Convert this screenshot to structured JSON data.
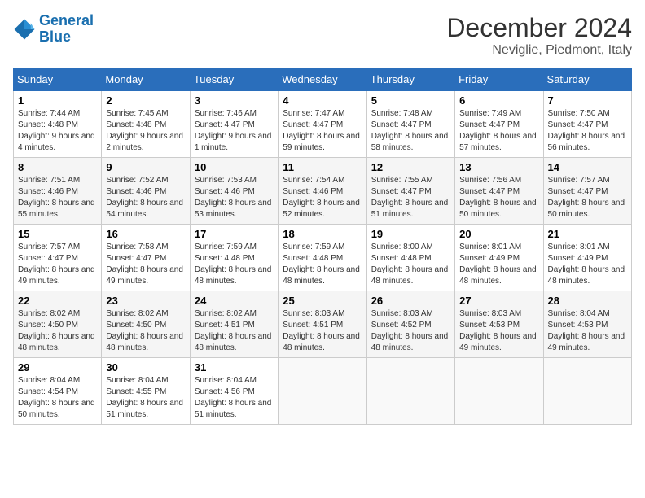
{
  "logo": {
    "text_general": "General",
    "text_blue": "Blue"
  },
  "header": {
    "month": "December 2024",
    "location": "Neviglie, Piedmont, Italy"
  },
  "days_of_week": [
    "Sunday",
    "Monday",
    "Tuesday",
    "Wednesday",
    "Thursday",
    "Friday",
    "Saturday"
  ],
  "weeks": [
    [
      {
        "day": "1",
        "sunrise": "7:44 AM",
        "sunset": "4:48 PM",
        "daylight": "9 hours and 4 minutes."
      },
      {
        "day": "2",
        "sunrise": "7:45 AM",
        "sunset": "4:48 PM",
        "daylight": "9 hours and 2 minutes."
      },
      {
        "day": "3",
        "sunrise": "7:46 AM",
        "sunset": "4:47 PM",
        "daylight": "9 hours and 1 minute."
      },
      {
        "day": "4",
        "sunrise": "7:47 AM",
        "sunset": "4:47 PM",
        "daylight": "8 hours and 59 minutes."
      },
      {
        "day": "5",
        "sunrise": "7:48 AM",
        "sunset": "4:47 PM",
        "daylight": "8 hours and 58 minutes."
      },
      {
        "day": "6",
        "sunrise": "7:49 AM",
        "sunset": "4:47 PM",
        "daylight": "8 hours and 57 minutes."
      },
      {
        "day": "7",
        "sunrise": "7:50 AM",
        "sunset": "4:47 PM",
        "daylight": "8 hours and 56 minutes."
      }
    ],
    [
      {
        "day": "8",
        "sunrise": "7:51 AM",
        "sunset": "4:46 PM",
        "daylight": "8 hours and 55 minutes."
      },
      {
        "day": "9",
        "sunrise": "7:52 AM",
        "sunset": "4:46 PM",
        "daylight": "8 hours and 54 minutes."
      },
      {
        "day": "10",
        "sunrise": "7:53 AM",
        "sunset": "4:46 PM",
        "daylight": "8 hours and 53 minutes."
      },
      {
        "day": "11",
        "sunrise": "7:54 AM",
        "sunset": "4:46 PM",
        "daylight": "8 hours and 52 minutes."
      },
      {
        "day": "12",
        "sunrise": "7:55 AM",
        "sunset": "4:47 PM",
        "daylight": "8 hours and 51 minutes."
      },
      {
        "day": "13",
        "sunrise": "7:56 AM",
        "sunset": "4:47 PM",
        "daylight": "8 hours and 50 minutes."
      },
      {
        "day": "14",
        "sunrise": "7:57 AM",
        "sunset": "4:47 PM",
        "daylight": "8 hours and 50 minutes."
      }
    ],
    [
      {
        "day": "15",
        "sunrise": "7:57 AM",
        "sunset": "4:47 PM",
        "daylight": "8 hours and 49 minutes."
      },
      {
        "day": "16",
        "sunrise": "7:58 AM",
        "sunset": "4:47 PM",
        "daylight": "8 hours and 49 minutes."
      },
      {
        "day": "17",
        "sunrise": "7:59 AM",
        "sunset": "4:48 PM",
        "daylight": "8 hours and 48 minutes."
      },
      {
        "day": "18",
        "sunrise": "7:59 AM",
        "sunset": "4:48 PM",
        "daylight": "8 hours and 48 minutes."
      },
      {
        "day": "19",
        "sunrise": "8:00 AM",
        "sunset": "4:48 PM",
        "daylight": "8 hours and 48 minutes."
      },
      {
        "day": "20",
        "sunrise": "8:01 AM",
        "sunset": "4:49 PM",
        "daylight": "8 hours and 48 minutes."
      },
      {
        "day": "21",
        "sunrise": "8:01 AM",
        "sunset": "4:49 PM",
        "daylight": "8 hours and 48 minutes."
      }
    ],
    [
      {
        "day": "22",
        "sunrise": "8:02 AM",
        "sunset": "4:50 PM",
        "daylight": "8 hours and 48 minutes."
      },
      {
        "day": "23",
        "sunrise": "8:02 AM",
        "sunset": "4:50 PM",
        "daylight": "8 hours and 48 minutes."
      },
      {
        "day": "24",
        "sunrise": "8:02 AM",
        "sunset": "4:51 PM",
        "daylight": "8 hours and 48 minutes."
      },
      {
        "day": "25",
        "sunrise": "8:03 AM",
        "sunset": "4:51 PM",
        "daylight": "8 hours and 48 minutes."
      },
      {
        "day": "26",
        "sunrise": "8:03 AM",
        "sunset": "4:52 PM",
        "daylight": "8 hours and 48 minutes."
      },
      {
        "day": "27",
        "sunrise": "8:03 AM",
        "sunset": "4:53 PM",
        "daylight": "8 hours and 49 minutes."
      },
      {
        "day": "28",
        "sunrise": "8:04 AM",
        "sunset": "4:53 PM",
        "daylight": "8 hours and 49 minutes."
      }
    ],
    [
      {
        "day": "29",
        "sunrise": "8:04 AM",
        "sunset": "4:54 PM",
        "daylight": "8 hours and 50 minutes."
      },
      {
        "day": "30",
        "sunrise": "8:04 AM",
        "sunset": "4:55 PM",
        "daylight": "8 hours and 51 minutes."
      },
      {
        "day": "31",
        "sunrise": "8:04 AM",
        "sunset": "4:56 PM",
        "daylight": "8 hours and 51 minutes."
      },
      null,
      null,
      null,
      null
    ]
  ]
}
